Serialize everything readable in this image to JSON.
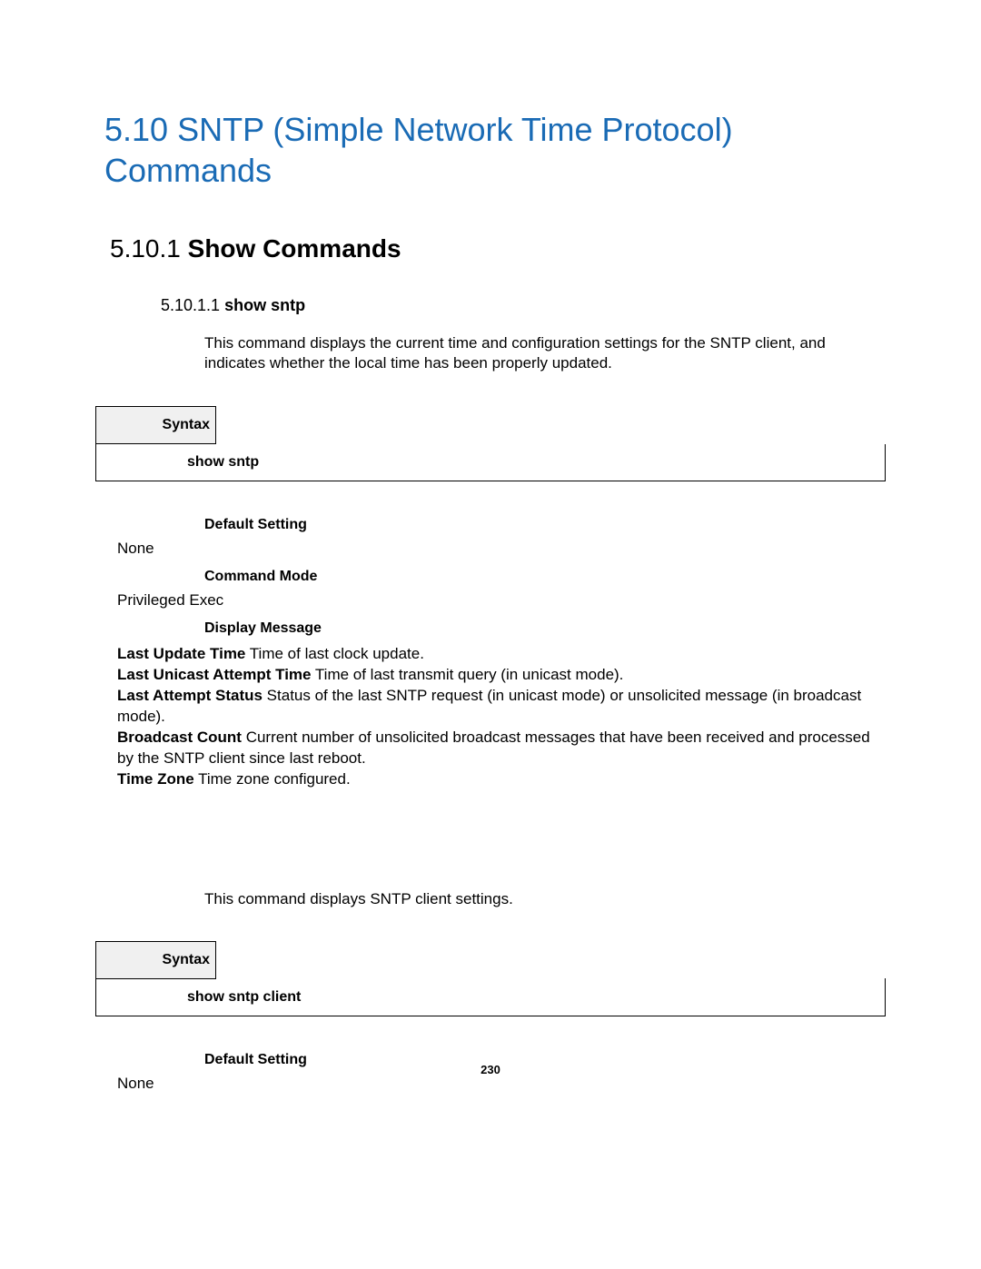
{
  "heading1": "5.10 SNTP (Simple Network Time Protocol) Commands",
  "heading2": {
    "num": "5.10.1 ",
    "title": "Show Commands"
  },
  "section1": {
    "heading3": {
      "num": "5.10.1.1 ",
      "title": "show sntp"
    },
    "description": "This command displays the current time and configuration settings for the SNTP client, and indicates whether the local time has been properly updated.",
    "syntax_label": "Syntax",
    "syntax_command": "show sntp",
    "default_setting_label": "Default Setting",
    "default_setting_value": "None",
    "command_mode_label": "Command Mode",
    "command_mode_value": "Privileged Exec",
    "display_message_label": "Display Message",
    "messages": [
      {
        "term": "Last Update Time",
        "text": " Time of last clock update."
      },
      {
        "term": "Last Unicast Attempt Time",
        "text": " Time of last transmit query (in unicast mode)."
      },
      {
        "term": "Last Attempt Status",
        "text": " Status of the last SNTP request (in unicast mode) or unsolicited message (in broadcast mode)."
      },
      {
        "term": "Broadcast Count",
        "text": " Current number of unsolicited broadcast messages that have been received and processed by the SNTP client since last reboot."
      },
      {
        "term": "Time Zone",
        "text": " Time zone configured."
      }
    ]
  },
  "section2": {
    "description": "This command displays SNTP client settings.",
    "syntax_label": "Syntax",
    "syntax_command": "show sntp client",
    "default_setting_label": "Default Setting",
    "default_setting_value": "None"
  },
  "page_number": "230"
}
